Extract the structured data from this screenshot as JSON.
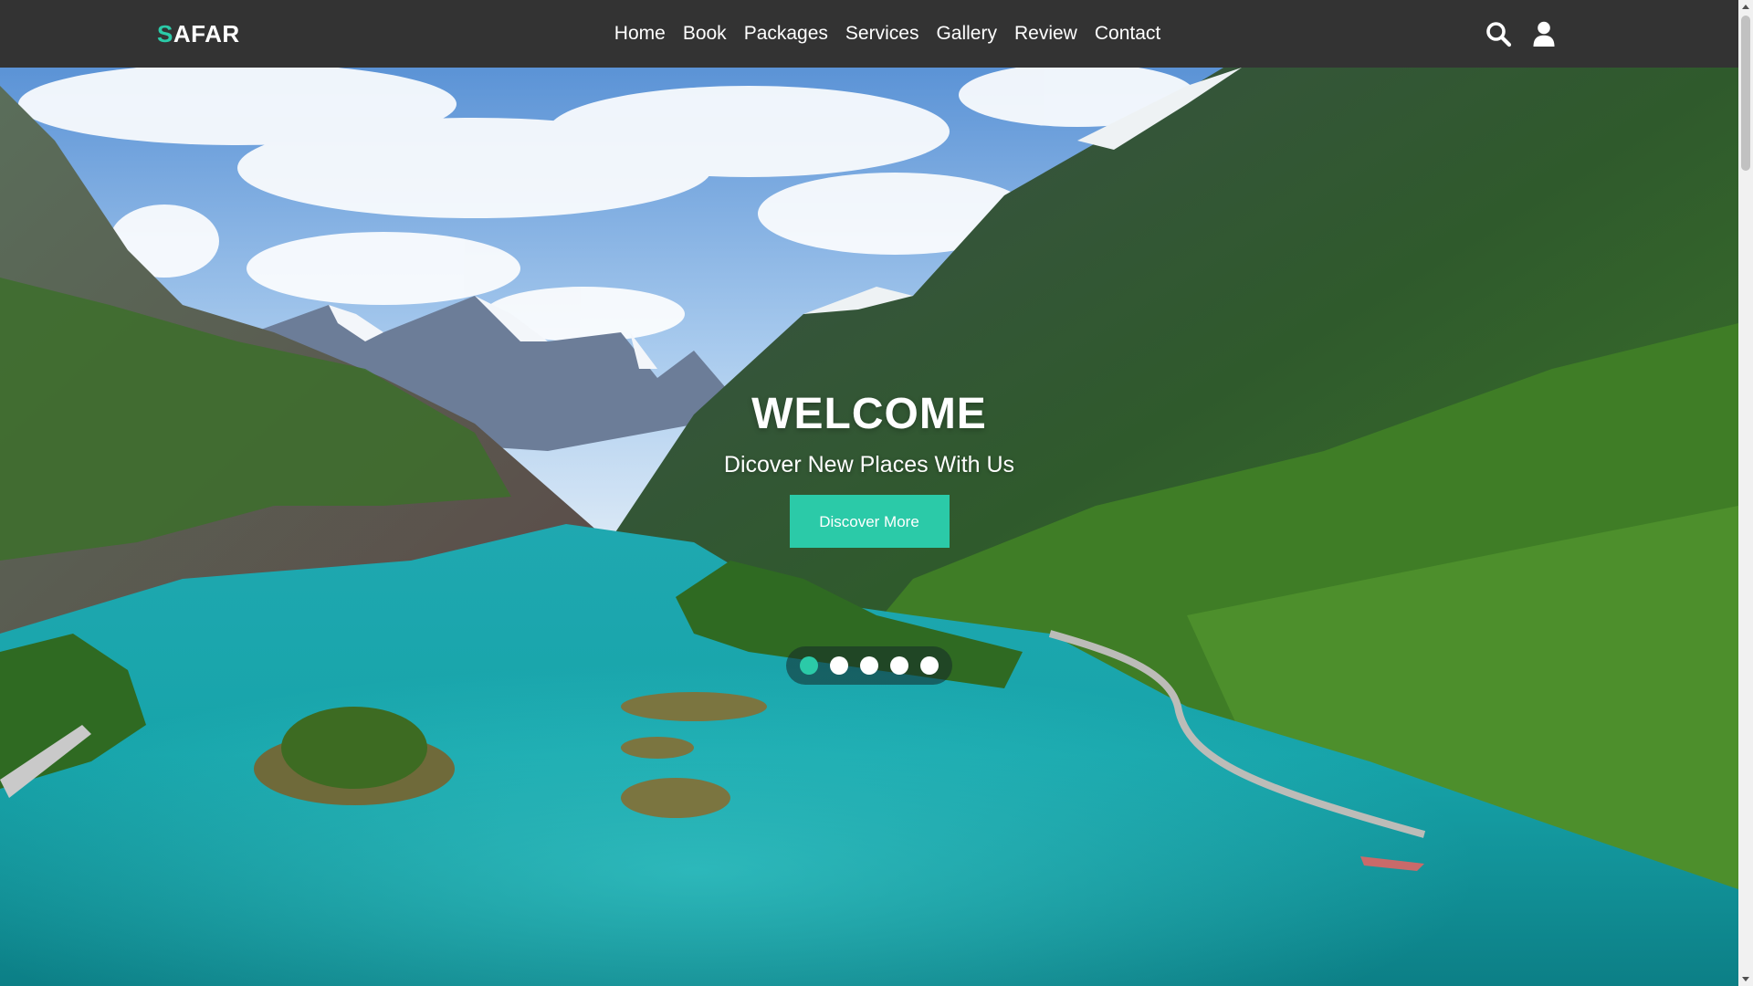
{
  "brand": {
    "logo_first": "S",
    "logo_rest": "AFAR",
    "accent_color": "#2bcaa8"
  },
  "nav": {
    "links": [
      "Home",
      "Book",
      "Packages",
      "Services",
      "Gallery",
      "Review",
      "Contact"
    ],
    "icons": [
      "search-icon",
      "user-icon"
    ]
  },
  "hero": {
    "title": "WELCOME",
    "subtitle": "Dicover New Places With Us",
    "button_label": "Discover More",
    "slides_total": 5,
    "active_slide": 1,
    "background": "mountain lake landscape"
  },
  "colors": {
    "navbar": "#333333",
    "accent": "#2bcaa8"
  }
}
